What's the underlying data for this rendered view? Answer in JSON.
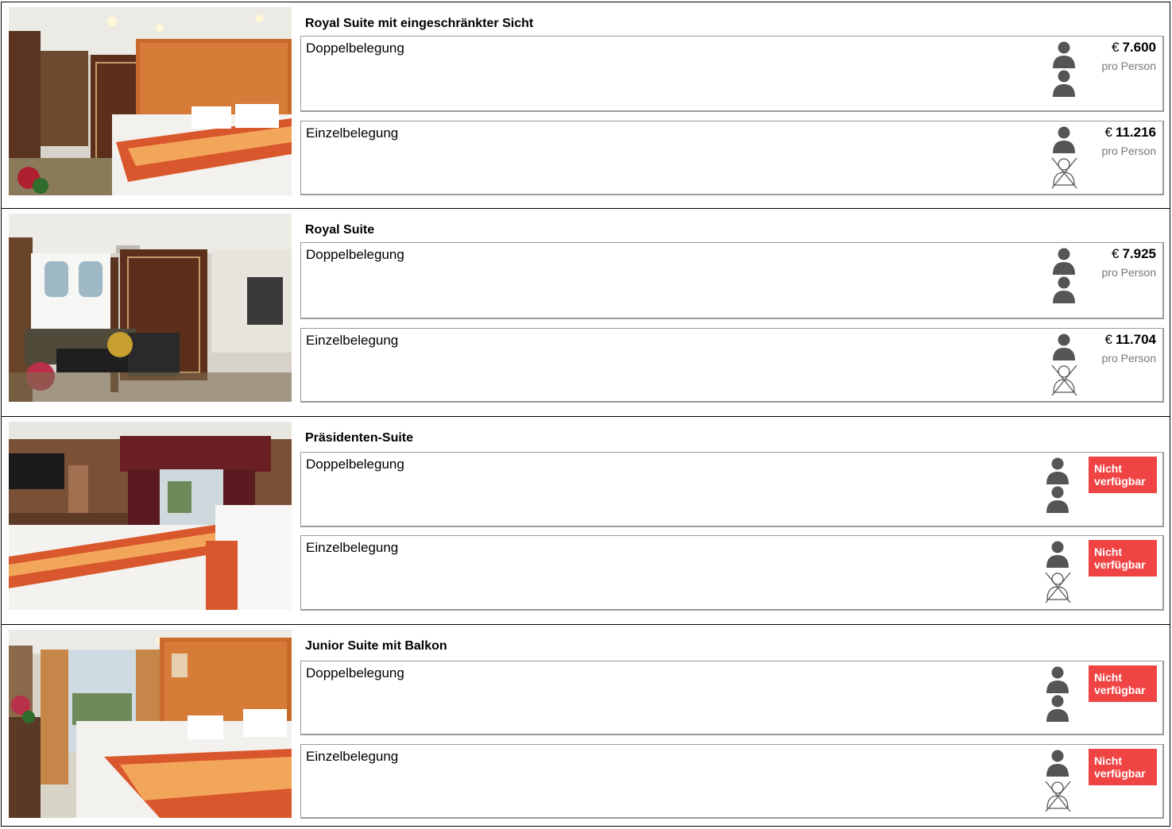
{
  "cabins": [
    {
      "title": "Royal Suite mit eingeschränkter Sicht",
      "photo": "suite-bedroom-photo",
      "occupancies": [
        {
          "label": "Doppelbelegung",
          "persons": "two-persons",
          "currency": "€",
          "price": "7.600",
          "unit": "pro Person",
          "available": true
        },
        {
          "label": "Einzelbelegung",
          "persons": "single-person",
          "currency": "€",
          "price": "11.216",
          "unit": "pro Person",
          "available": true
        }
      ]
    },
    {
      "title": "Royal Suite",
      "photo": "suite-living-room-photo",
      "occupancies": [
        {
          "label": "Doppelbelegung",
          "persons": "two-persons",
          "currency": "€",
          "price": "7.925",
          "unit": "pro Person",
          "available": true
        },
        {
          "label": "Einzelbelegung",
          "persons": "single-person",
          "currency": "€",
          "price": "11.704",
          "unit": "pro Person",
          "available": true
        }
      ]
    },
    {
      "title": "Präsidenten-Suite",
      "photo": "presidential-suite-photo",
      "occupancies": [
        {
          "label": "Doppelbelegung",
          "persons": "two-persons",
          "status": "Nicht verfügbar",
          "available": false
        },
        {
          "label": "Einzelbelegung",
          "persons": "single-person",
          "status": "Nicht verfügbar",
          "available": false
        }
      ]
    },
    {
      "title": "Junior Suite mit Balkon",
      "photo": "junior-suite-balcony-photo",
      "occupancies": [
        {
          "label": "Doppelbelegung",
          "persons": "two-persons",
          "status": "Nicht verfügbar",
          "available": false
        },
        {
          "label": "Einzelbelegung",
          "persons": "single-person",
          "status": "Nicht verfügbar",
          "available": false
        }
      ]
    }
  ],
  "colors": {
    "unavailable": "#f04444",
    "person_icon": "#555555",
    "card_border": "#9a9a9a"
  }
}
